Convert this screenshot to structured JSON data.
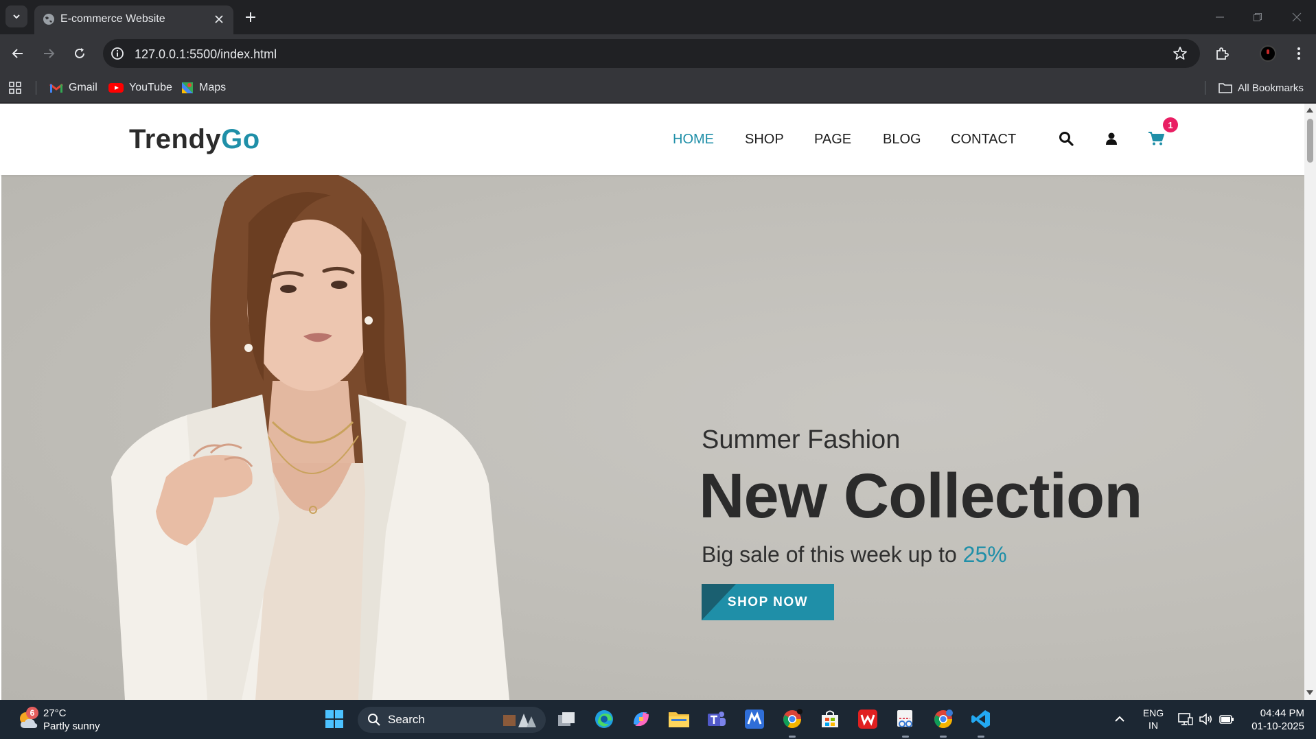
{
  "browser": {
    "tab_title": "E-commerce Website",
    "url": "127.0.0.1:5500/index.html",
    "bookmarks": [
      {
        "label": "Gmail",
        "icon": "gmail-icon"
      },
      {
        "label": "YouTube",
        "icon": "youtube-icon"
      },
      {
        "label": "Maps",
        "icon": "maps-icon"
      }
    ],
    "all_bookmarks_label": "All Bookmarks"
  },
  "site": {
    "logo_main": "Trendy",
    "logo_accent": "Go",
    "nav": [
      {
        "label": "HOME",
        "active": true
      },
      {
        "label": "SHOP",
        "active": false
      },
      {
        "label": "PAGE",
        "active": false
      },
      {
        "label": "BLOG",
        "active": false
      },
      {
        "label": "CONTACT",
        "active": false
      }
    ],
    "cart_count": "1",
    "colors": {
      "accent": "#1f8fa8",
      "text": "#2b2b2b",
      "badge": "#e91e63"
    }
  },
  "hero": {
    "subtitle": "Summer Fashion",
    "headline": "New Collection",
    "sale_text": "Big sale of this week up to ",
    "sale_pct": "25%",
    "button_label": "SHOP NOW"
  },
  "taskbar": {
    "weather_badge": "6",
    "temperature": "27°C",
    "condition": "Partly sunny",
    "search_label": "Search",
    "language_1": "ENG",
    "language_2": "IN",
    "time": "04:44 PM",
    "date": "01-10-2025"
  }
}
